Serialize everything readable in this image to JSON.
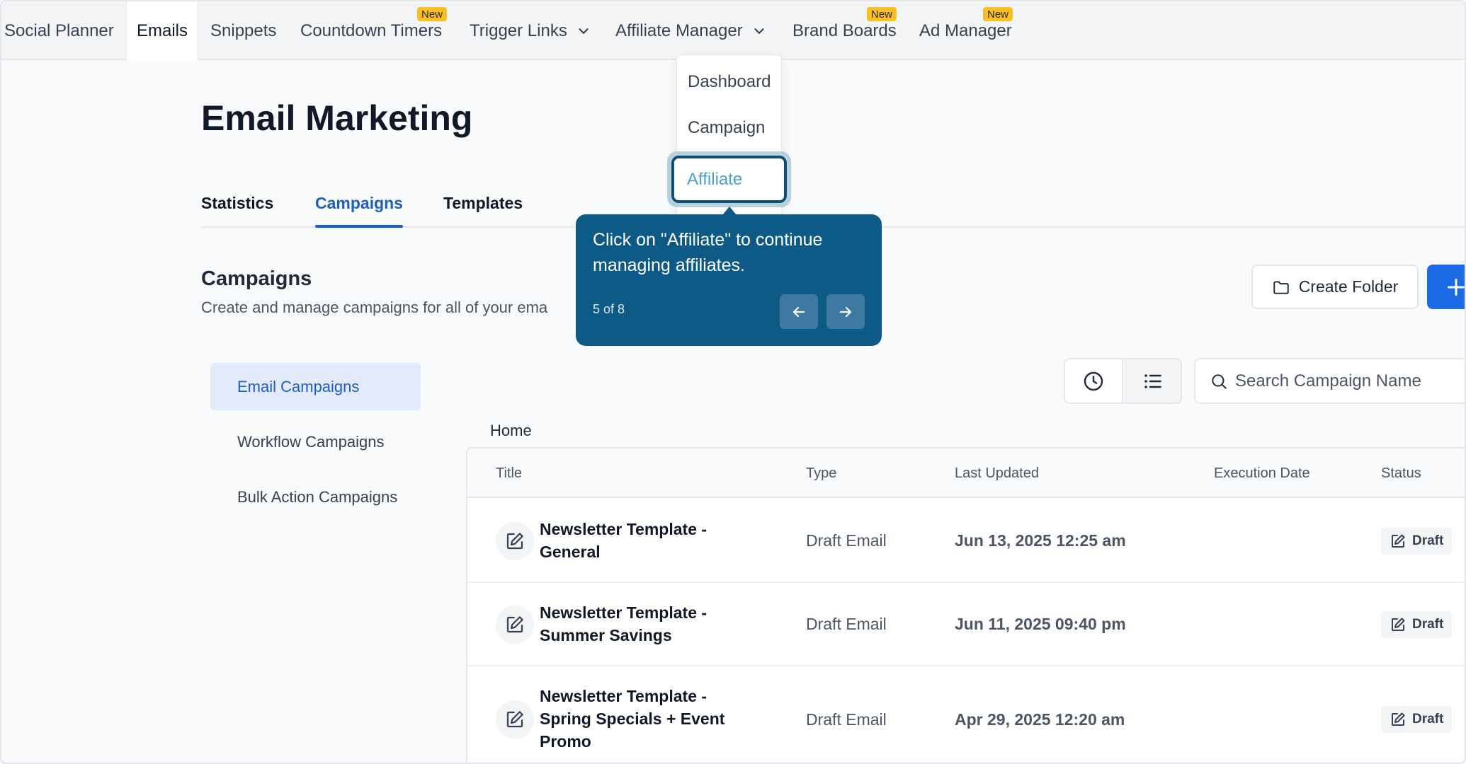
{
  "nav": {
    "items": [
      {
        "label": "Social Planner"
      },
      {
        "label": "Emails"
      },
      {
        "label": "Snippets"
      },
      {
        "label": "Countdown Timers",
        "badge": "New"
      },
      {
        "label": "Trigger Links"
      },
      {
        "label": "Affiliate Manager"
      },
      {
        "label": "Brand Boards",
        "badge": "New"
      },
      {
        "label": "Ad Manager",
        "badge": "New"
      }
    ]
  },
  "dropdown": {
    "items": [
      {
        "label": "Dashboard"
      },
      {
        "label": "Campaign"
      },
      {
        "label": "Affiliate"
      }
    ]
  },
  "tooltip": {
    "text": "Click on \"Affiliate\" to continue managing affiliates.",
    "step": "5 of 8"
  },
  "page": {
    "title": "Email Marketing",
    "tabs": [
      {
        "label": "Statistics"
      },
      {
        "label": "Campaigns"
      },
      {
        "label": "Templates"
      }
    ]
  },
  "campaigns": {
    "title": "Campaigns",
    "subtitle": "Create and manage campaigns for all of your ema",
    "create_folder_label": "Create Folder",
    "search_placeholder": "Search Campaign Name",
    "breadcrumb": "Home"
  },
  "sidebar": {
    "items": [
      {
        "label": "Email Campaigns"
      },
      {
        "label": "Workflow Campaigns"
      },
      {
        "label": "Bulk Action Campaigns"
      }
    ]
  },
  "table": {
    "headers": [
      "Title",
      "Type",
      "Last Updated",
      "Execution Date",
      "Status"
    ],
    "rows": [
      {
        "title_line1": "Newsletter Template -",
        "title_line2": "General",
        "title_line3": "",
        "type": "Draft Email",
        "last_updated": "Jun 13, 2025 12:25 am",
        "execution_date": "",
        "status": "Draft"
      },
      {
        "title_line1": "Newsletter Template -",
        "title_line2": "Summer Savings",
        "title_line3": "",
        "type": "Draft Email",
        "last_updated": "Jun 11, 2025 09:40 pm",
        "execution_date": "",
        "status": "Draft"
      },
      {
        "title_line1": "Newsletter Template -",
        "title_line2": "Spring Specials + Event",
        "title_line3": "Promo",
        "type": "Draft Email",
        "last_updated": "Apr 29, 2025 12:20 am",
        "execution_date": "",
        "status": "Draft"
      }
    ]
  },
  "colors": {
    "accent": "#1d5fbf",
    "primary_button": "#1d6ae5",
    "tooltip_bg": "#0e5a86",
    "badge": "#fbbf24"
  },
  "icons": {
    "folder": "folder-icon",
    "plus": "plus-icon",
    "clock": "clock-icon",
    "list": "list-icon",
    "search": "search-icon",
    "edit": "edit-icon",
    "chevron": "chevron-down-icon",
    "arrow_left": "arrow-left-icon",
    "arrow_right": "arrow-right-icon"
  }
}
